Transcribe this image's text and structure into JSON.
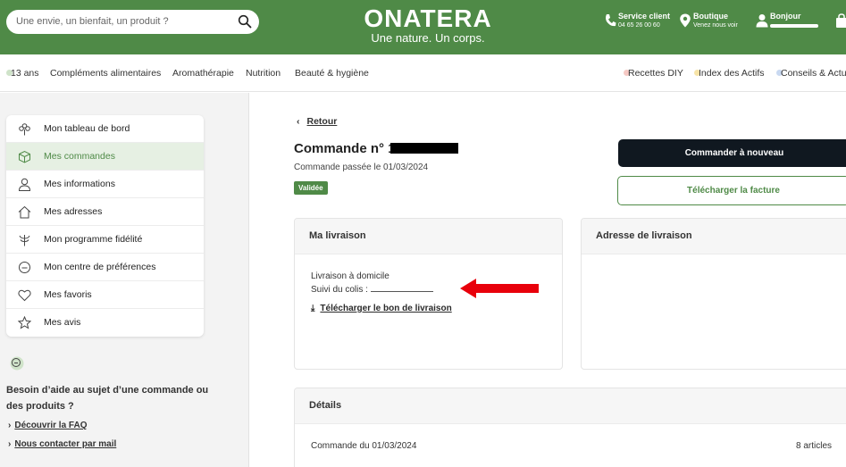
{
  "header": {
    "search_placeholder": "Une envie, un bienfait, un produit ?",
    "logo_word": "ONATERA",
    "logo_tagline": "Une nature. Un corps.",
    "service": {
      "title": "Service client",
      "sub": "04 65 26 00 60"
    },
    "shop": {
      "title": "Boutique",
      "sub": "Venez nous voir"
    },
    "account": {
      "title": "Bonjour"
    },
    "icons": [
      "search-icon",
      "phone-icon",
      "location-pin-icon",
      "user-icon",
      "shopping-bag-icon"
    ],
    "brand_color": "#4f8a47"
  },
  "nav": {
    "items": [
      "13 ans",
      "Compléments alimentaires",
      "Aromathérapie",
      "Nutrition",
      "Beauté & hygiène"
    ],
    "right_items": [
      "Recettes DIY",
      "Index des Actifs",
      "Conseils & Actu"
    ]
  },
  "sidebar": {
    "items": [
      {
        "label": "Mon tableau de bord",
        "icon": "flower-icon"
      },
      {
        "label": "Mes commandes",
        "icon": "box-icon",
        "active": true
      },
      {
        "label": "Mes informations",
        "icon": "user-icon"
      },
      {
        "label": "Mes adresses",
        "icon": "home-icon"
      },
      {
        "label": "Mon programme fidélité",
        "icon": "plant-icon"
      },
      {
        "label": "Mon centre de préférences",
        "icon": "settings-circle-icon"
      },
      {
        "label": "Mes favoris",
        "icon": "heart-icon"
      },
      {
        "label": "Mes avis",
        "icon": "star-icon"
      }
    ],
    "help": {
      "title": "Besoin d’aide au sujet d’une commande ou des produits ?",
      "faq": "Découvrir la FAQ",
      "contact": "Nous contacter par mail"
    }
  },
  "main": {
    "back": "Retour",
    "order_title": "Commande n° 1",
    "order_date": "Commande passée le 01/03/2024",
    "status": "Validée",
    "reorder": "Commander à nouveau",
    "invoice": "Télécharger la facture",
    "delivery": {
      "title": "Ma livraison",
      "mode": "Livraison à domicile",
      "tracking_label": "Suivi du colis :",
      "download": "Télécharger le bon de livraison"
    },
    "address": {
      "title": "Adresse de livraison"
    },
    "details": {
      "title": "Détails",
      "order_line": "Commande du 01/03/2024",
      "count": "8 articles"
    }
  }
}
